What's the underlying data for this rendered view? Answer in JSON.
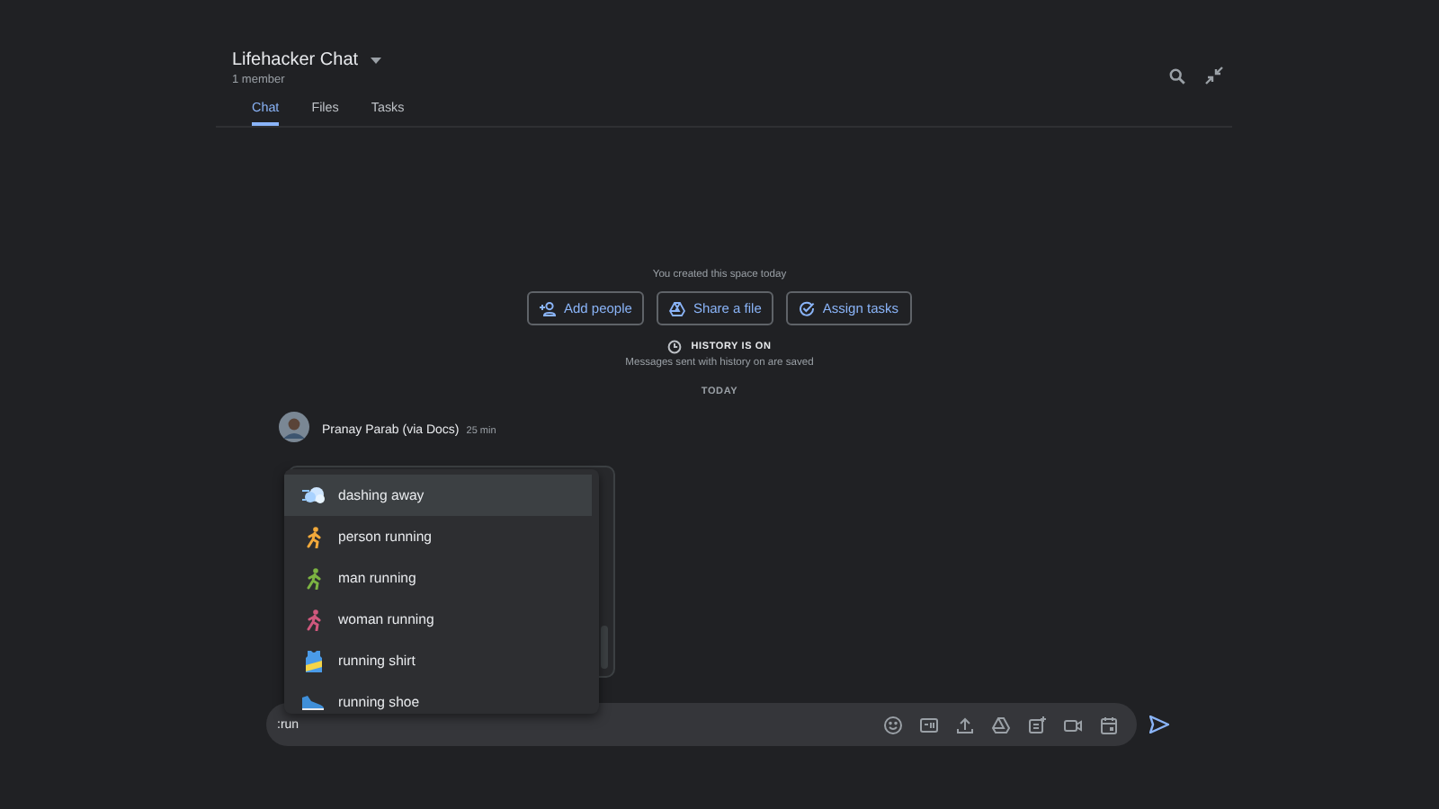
{
  "header": {
    "title": "Lifehacker Chat",
    "subtitle": "1 member",
    "tabs": [
      {
        "label": "Chat",
        "selected": true
      },
      {
        "label": "Files",
        "selected": false
      },
      {
        "label": "Tasks",
        "selected": false
      }
    ]
  },
  "intro": {
    "created": "You created this space today",
    "actions": [
      {
        "label": "Add people"
      },
      {
        "label": "Share a file"
      },
      {
        "label": "Assign tasks"
      }
    ],
    "history_title": "HISTORY IS ON",
    "history_note": "Messages sent with history on are saved",
    "date_divider": "TODAY"
  },
  "message": {
    "author": "Pranay Parab (via Docs)",
    "time": "25 min"
  },
  "suggestions": [
    {
      "label": "dashing away",
      "selected": true
    },
    {
      "label": "person running",
      "selected": false
    },
    {
      "label": "man running",
      "selected": false
    },
    {
      "label": "woman running",
      "selected": false
    },
    {
      "label": "running shirt",
      "selected": false
    },
    {
      "label": "running shoe",
      "selected": false
    }
  ],
  "composer": {
    "value": ":run"
  }
}
